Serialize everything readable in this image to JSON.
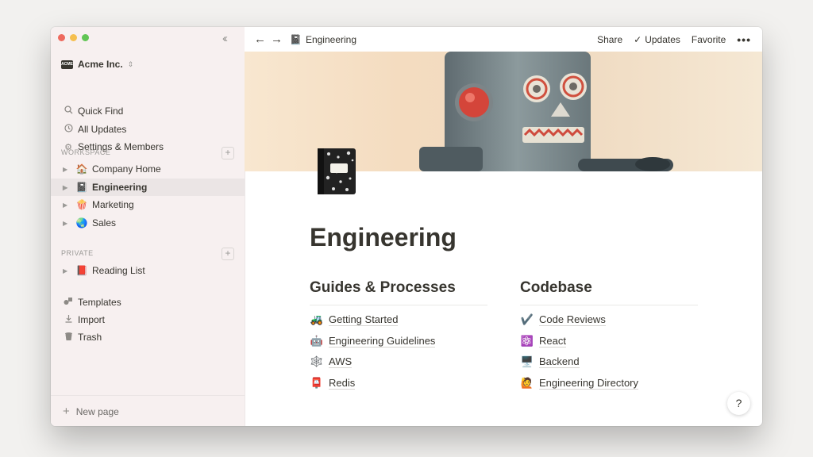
{
  "window": {
    "traffic_colors": [
      "#ee6a5e",
      "#f5bf4f",
      "#61c554"
    ]
  },
  "sidebar": {
    "collapse_icon": "double-chevron-left-icon",
    "workspace": {
      "logo_text": "ACME",
      "name": "Acme Inc.",
      "caret": "⌃⌄"
    },
    "top_items": [
      {
        "icon": "search-icon",
        "label": "Quick Find"
      },
      {
        "icon": "clock-icon",
        "label": "All Updates"
      },
      {
        "icon": "gear-icon",
        "label": "Settings & Members"
      }
    ],
    "workspace_label": "WORKSPACE",
    "workspace_pages": [
      {
        "emoji": "🏠",
        "label": "Company Home",
        "active": false
      },
      {
        "emoji": "📓",
        "label": "Engineering",
        "active": true
      },
      {
        "emoji": "🍿",
        "label": "Marketing",
        "active": false
      },
      {
        "emoji": "🌏",
        "label": "Sales",
        "active": false
      }
    ],
    "private_label": "PRIVATE",
    "private_pages": [
      {
        "emoji": "📕",
        "label": "Reading List"
      }
    ],
    "bottom_items": [
      {
        "icon": "templates-icon",
        "label": "Templates"
      },
      {
        "icon": "import-icon",
        "label": "Import"
      },
      {
        "icon": "trash-icon",
        "label": "Trash"
      }
    ],
    "new_page_label": "New page"
  },
  "topbar": {
    "breadcrumb_emoji": "📓",
    "breadcrumb": "Engineering",
    "share": "Share",
    "updates": "Updates",
    "favorite": "Favorite",
    "more": "•••"
  },
  "page": {
    "title": "Engineering",
    "columns": [
      {
        "heading": "Guides & Processes",
        "links": [
          {
            "emoji": "🚜",
            "label": "Getting Started"
          },
          {
            "emoji": "🤖",
            "label": "Engineering Guidelines"
          },
          {
            "emoji": "🕸️",
            "label": "AWS"
          },
          {
            "emoji": "📮",
            "label": "Redis"
          }
        ]
      },
      {
        "heading": "Codebase",
        "links": [
          {
            "emoji": "✔️",
            "label": "Code Reviews"
          },
          {
            "emoji": "⚛️",
            "label": "React"
          },
          {
            "emoji": "🖥️",
            "label": "Backend"
          },
          {
            "emoji": "🙋",
            "label": "Engineering Directory"
          }
        ]
      }
    ]
  },
  "help": "?"
}
